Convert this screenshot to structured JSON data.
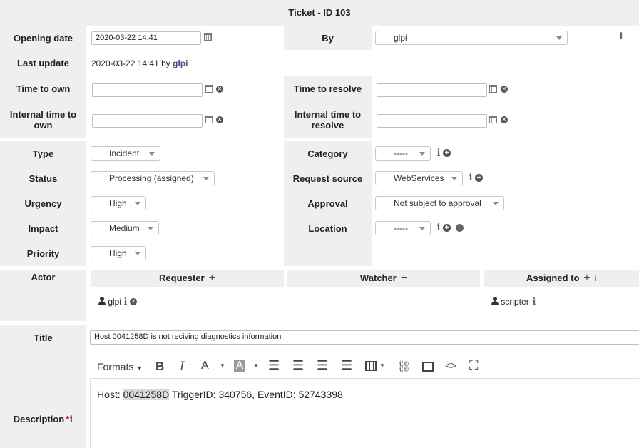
{
  "header": {
    "title": "Ticket - ID 103"
  },
  "fields": {
    "opening_date": {
      "label": "Opening date",
      "value": "2020-03-22 14:41"
    },
    "by": {
      "label": "By",
      "value": "glpi"
    },
    "last_update": {
      "label": "Last update",
      "value": "2020-03-22 14:41 by",
      "user": "glpi"
    },
    "time_to_own": {
      "label": "Time to own",
      "value": ""
    },
    "time_to_resolve": {
      "label": "Time to resolve",
      "value": ""
    },
    "internal_time_to_own": {
      "label": "Internal time to own",
      "value": ""
    },
    "internal_time_to_resolve": {
      "label": "Internal time to resolve",
      "value": ""
    },
    "type": {
      "label": "Type",
      "value": "Incident"
    },
    "category": {
      "label": "Category",
      "value": "-----"
    },
    "status": {
      "label": "Status",
      "value": "Processing (assigned)"
    },
    "request_source": {
      "label": "Request source",
      "value": "WebServices"
    },
    "urgency": {
      "label": "Urgency",
      "value": "High"
    },
    "approval": {
      "label": "Approval",
      "value": "Not subject to approval"
    },
    "impact": {
      "label": "Impact",
      "value": "Medium"
    },
    "location": {
      "label": "Location",
      "value": "-----"
    },
    "priority": {
      "label": "Priority",
      "value": "High"
    }
  },
  "actors": {
    "label": "Actor",
    "requester": {
      "header": "Requester",
      "user": "glpi"
    },
    "watcher": {
      "header": "Watcher"
    },
    "assigned": {
      "header": "Assigned to",
      "user": "scripter"
    }
  },
  "title_field": {
    "label": "Title",
    "value": "Host 0041258D is not reciving diagnostics information"
  },
  "description": {
    "label": "Description",
    "required_mark": "*",
    "toolbar": {
      "formats": "Formats"
    },
    "content": {
      "prefix": "Host: ",
      "highlight": "0041258D",
      "rest": " TriggerID: 340756, EventID: 52743398"
    }
  },
  "icons": {
    "info": "i",
    "clear": "✕",
    "plus": "+"
  }
}
